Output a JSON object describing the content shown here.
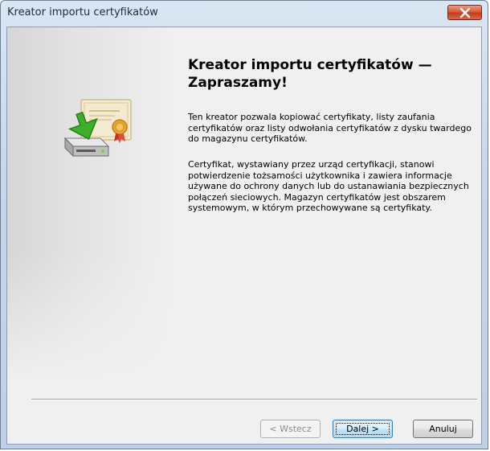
{
  "window": {
    "title": "Kreator importu certyfikatów"
  },
  "content": {
    "heading": "Kreator importu certyfikatów — Zapraszamy!",
    "paragraph1": "Ten kreator pozwala kopiować certyfikaty, listy zaufania certyfikatów oraz listy odwołania certyfikatów z dysku twardego do magazynu certyfikatów.",
    "paragraph2": "Certyfikat, wystawiany przez urząd certyfikacji, stanowi potwierdzenie tożsamości użytkownika i zawiera informacje używane do ochrony danych lub do ustanawiania bezpiecznych połączeń sieciowych. Magazyn certyfikatów jest obszarem systemowym, w którym przechowywane są certyfikaty."
  },
  "buttons": {
    "back": "< Wstecz",
    "next": "Dalej >",
    "cancel": "Anuluj"
  },
  "icons": {
    "close": "close-icon",
    "wizard_art": "certificate-import-icon"
  },
  "colors": {
    "close_button": "#d8552f",
    "default_button_border": "#3c7fb1",
    "title_bar": "#c7d7ea"
  },
  "state": {
    "back_enabled": false,
    "next_default": true
  }
}
